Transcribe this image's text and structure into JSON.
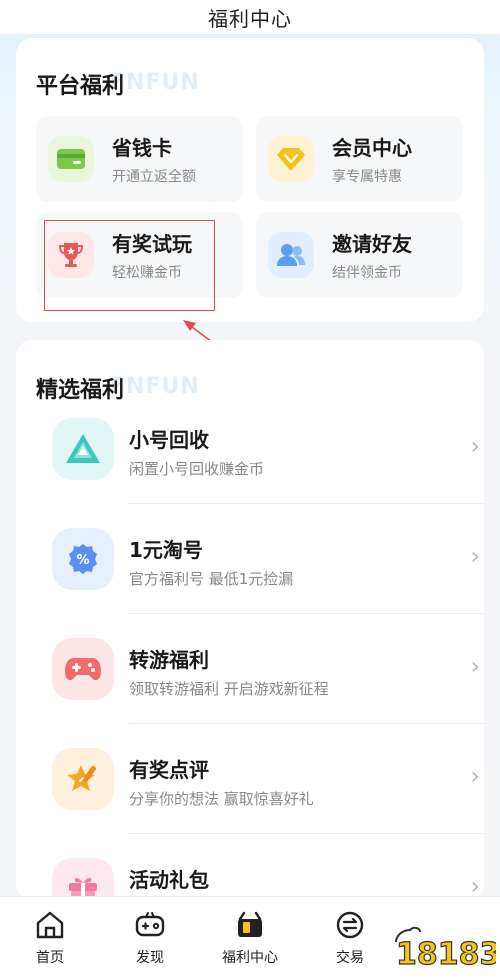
{
  "header": {
    "title": "福利中心"
  },
  "platform": {
    "title": "平台福利",
    "watermark": "FNFUN",
    "tiles": [
      {
        "name": "省钱卡",
        "desc": "开通立返全额",
        "icon": "card-icon",
        "color": "#7cc84a"
      },
      {
        "name": "会员中心",
        "desc": "享专属特惠",
        "icon": "diamond-icon",
        "color": "#f4c21a"
      },
      {
        "name": "有奖试玩",
        "desc": "轻松赚金币",
        "icon": "trophy-icon",
        "color": "#e85a5a"
      },
      {
        "name": "邀请好友",
        "desc": "结伴领金币",
        "icon": "friends-icon",
        "color": "#5b9ef0"
      }
    ]
  },
  "featured": {
    "title": "精选福利",
    "watermark": "FNFUN",
    "items": [
      {
        "name": "小号回收",
        "desc": "闲置小号回收赚金币",
        "icon": "recycle-icon",
        "color": "#3cc7c0"
      },
      {
        "name": "1元淘号",
        "desc": "官方福利号 最低1元捡漏",
        "icon": "discount-icon",
        "color": "#5b8ff0"
      },
      {
        "name": "转游福利",
        "desc": "领取转游福利 开启游戏新征程",
        "icon": "gamepad-icon",
        "color": "#f26b6b"
      },
      {
        "name": "有奖点评",
        "desc": "分享你的想法 赢取惊喜好礼",
        "icon": "star-pen-icon",
        "color": "#f5a623"
      },
      {
        "name": "活动礼包",
        "desc": "",
        "icon": "gift-icon",
        "color": "#f07aa0"
      }
    ]
  },
  "tabbar": {
    "items": [
      {
        "label": "首页",
        "icon": "home-icon"
      },
      {
        "label": "发现",
        "icon": "discover-icon"
      },
      {
        "label": "福利中心",
        "icon": "welfare-icon",
        "active": true
      },
      {
        "label": "交易",
        "icon": "trade-icon"
      }
    ]
  },
  "logo": {
    "text": "18183"
  },
  "accent": {
    "highlight": "#e04b4b"
  }
}
